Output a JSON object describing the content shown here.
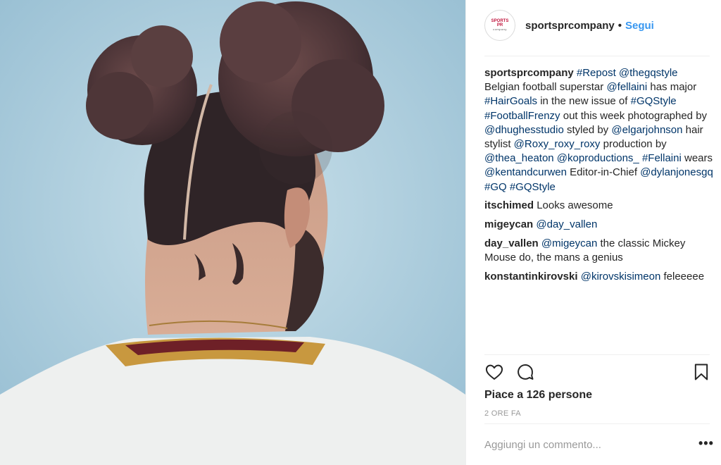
{
  "post": {
    "username": "sportsprcompany",
    "separator": "•",
    "follow_label": "Segui",
    "avatar_logo": {
      "line1": "SPORTS PR",
      "line2": "company"
    }
  },
  "comments": [
    {
      "user": "sportsprcompany",
      "parts": [
        {
          "t": "#Repost @thegqstyle",
          "link": true
        },
        {
          "t": "\nBelgian football superstar ",
          "link": false
        },
        {
          "t": "@fellaini",
          "link": true
        },
        {
          "t": " has major ",
          "link": false
        },
        {
          "t": "#HairGoals",
          "link": true
        },
        {
          "t": " in the new issue of ",
          "link": false
        },
        {
          "t": "#GQStyle #FootballFrenzy",
          "link": true
        },
        {
          "t": " out this week photographed by ",
          "link": false
        },
        {
          "t": "@dhughesstudio",
          "link": true
        },
        {
          "t": " styled by ",
          "link": false
        },
        {
          "t": "@elgarjohnson",
          "link": true
        },
        {
          "t": " hair stylist ",
          "link": false
        },
        {
          "t": "@Roxy_roxy_roxy",
          "link": true
        },
        {
          "t": " production by ",
          "link": false
        },
        {
          "t": "@thea_heaton @koproductions_ #Fellaini",
          "link": true
        },
        {
          "t": " wears ",
          "link": false
        },
        {
          "t": "@kentandcurwen",
          "link": true
        },
        {
          "t": " Editor-in-Chief ",
          "link": false
        },
        {
          "t": "@dylanjonesgq #GQ #GQStyle",
          "link": true
        }
      ]
    },
    {
      "user": "itschimed",
      "parts": [
        {
          "t": "Looks awesome",
          "link": false
        }
      ]
    },
    {
      "user": "migeycan",
      "parts": [
        {
          "t": "@day_vallen",
          "link": true
        }
      ]
    },
    {
      "user": "day_vallen",
      "parts": [
        {
          "t": "@migeycan",
          "link": true
        },
        {
          "t": " the classic Mickey Mouse do, the mans a genius",
          "link": false
        }
      ]
    },
    {
      "user": "konstantinkirovski",
      "parts": [
        {
          "t": "@kirovskisimeon",
          "link": true
        },
        {
          "t": " feleeeee",
          "link": false
        }
      ]
    }
  ],
  "actions": {
    "like_icon": "heart-icon",
    "comment_icon": "comment-bubble-icon",
    "save_icon": "bookmark-icon"
  },
  "likes_text": "Piace a 126 persone",
  "time_text": "2 ORE FA",
  "comment_input": {
    "placeholder": "Aggiungi un commento...",
    "value": ""
  },
  "more_label": "•••"
}
